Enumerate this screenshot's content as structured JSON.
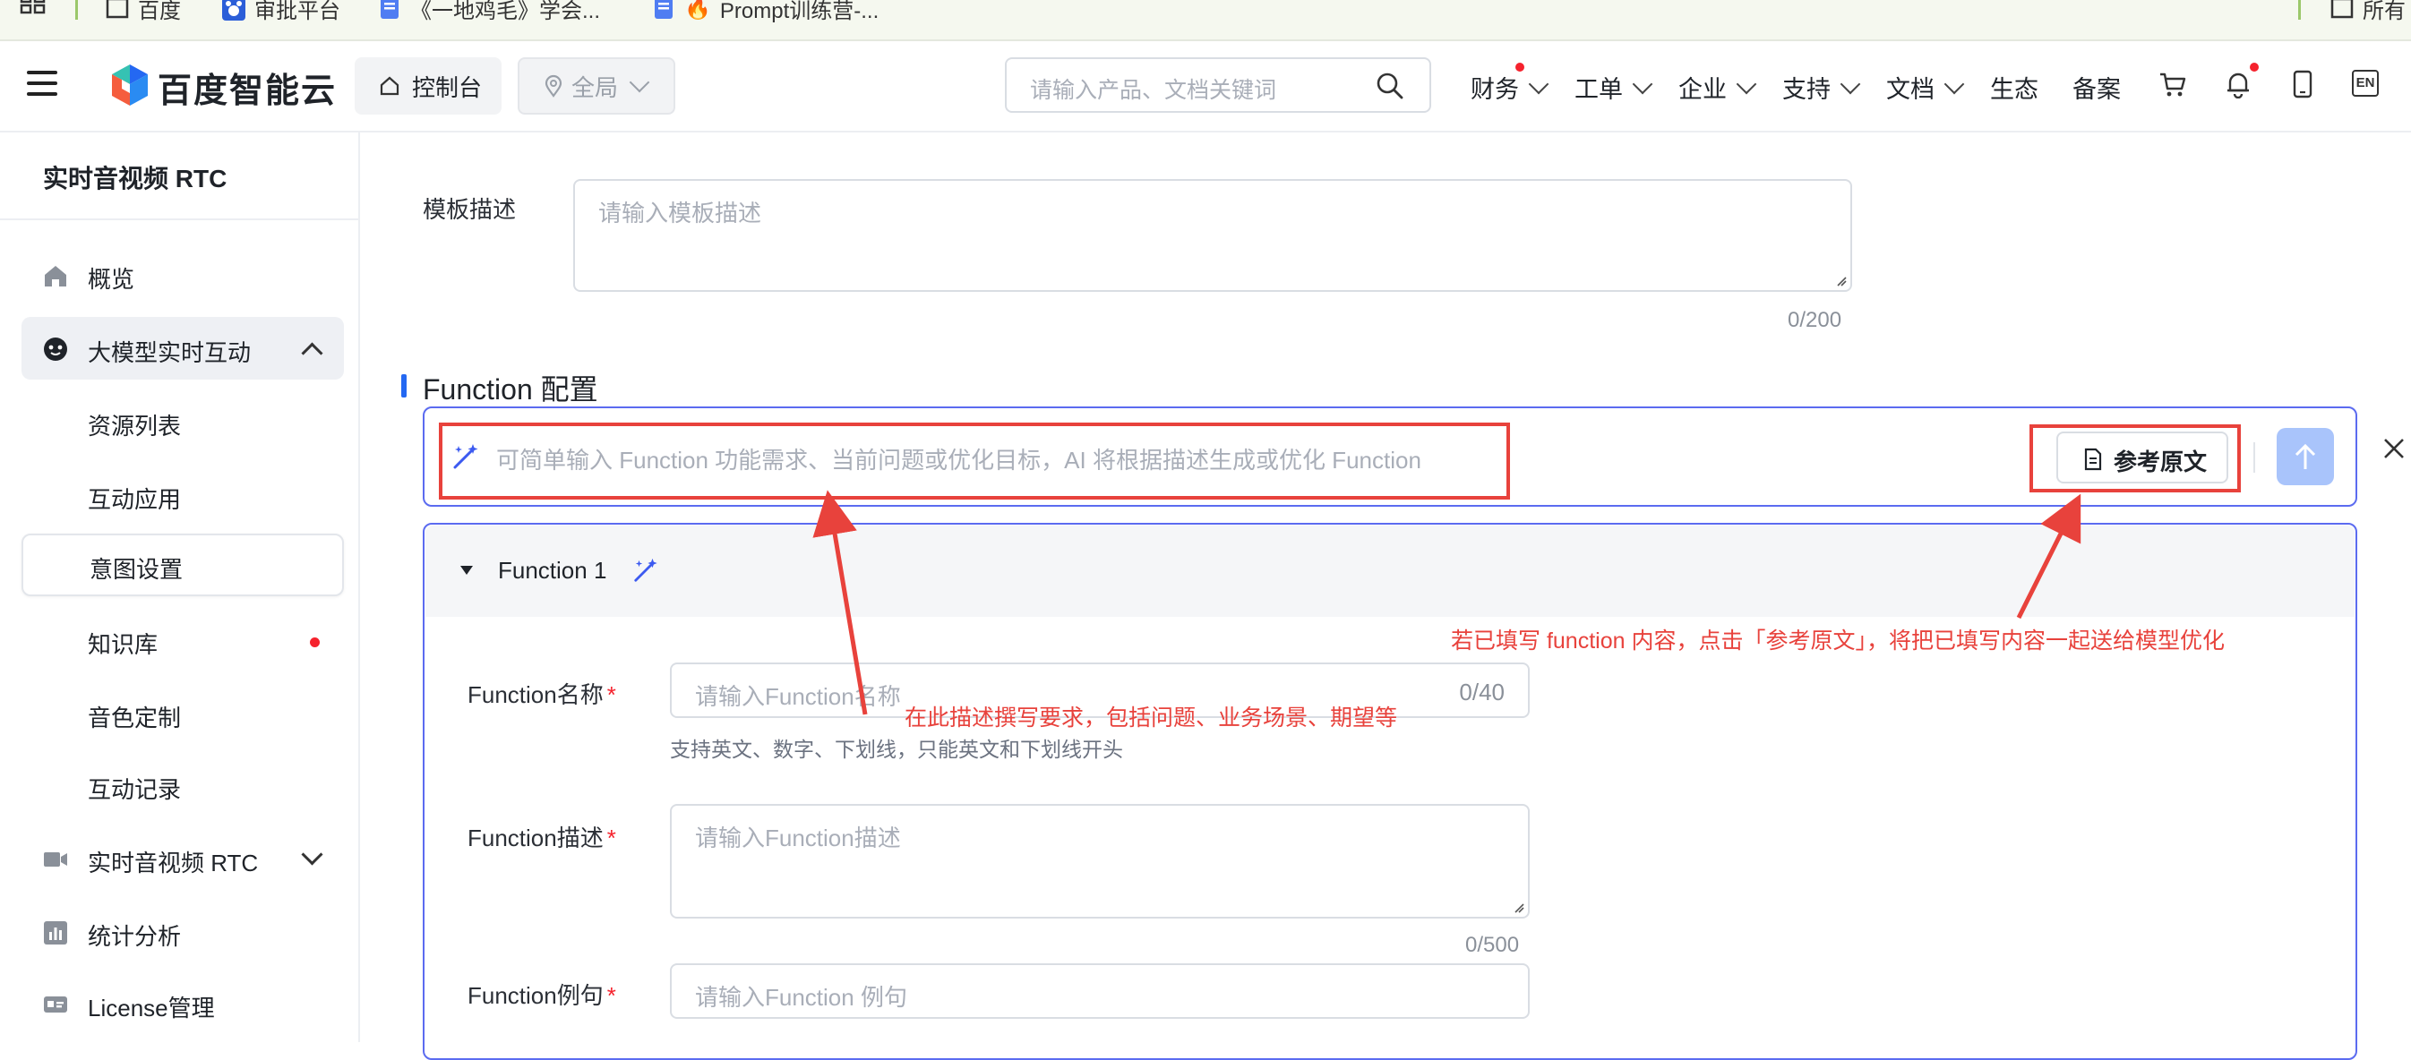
{
  "bookmarks": {
    "items": [
      "百度",
      "审批平台",
      "《一地鸡毛》学会...",
      "Prompt训练营-..."
    ],
    "right_label": "所有"
  },
  "header": {
    "logo_text": "百度智能云",
    "console_label": "控制台",
    "region_label": "全局",
    "search_placeholder": "请输入产品、文档关键词",
    "nav": [
      "财务",
      "工单",
      "企业",
      "支持",
      "文档",
      "生态",
      "备案"
    ],
    "lang_label": "EN"
  },
  "sidebar": {
    "title": "实时音视频 RTC",
    "items": [
      {
        "label": "概览"
      },
      {
        "label": "大模型实时互动"
      },
      {
        "label": "资源列表"
      },
      {
        "label": "互动应用"
      },
      {
        "label": "意图设置"
      },
      {
        "label": "知识库"
      },
      {
        "label": "音色定制"
      },
      {
        "label": "互动记录"
      },
      {
        "label": "实时音视频 RTC"
      },
      {
        "label": "统计分析"
      },
      {
        "label": "License管理"
      }
    ]
  },
  "form": {
    "template_desc_label": "模板描述",
    "template_desc_placeholder": "请输入模板描述",
    "template_desc_counter": "0/200",
    "function_section_title": "Function 配置",
    "ai_input_placeholder": "可简单输入 Function 功能需求、当前问题或优化目标，AI 将根据描述生成或优化 Function",
    "reference_button": "参考原文",
    "function_card_title": "Function 1",
    "name_label": "Function名称",
    "name_placeholder": "请输入Function名称",
    "name_counter": "0/40",
    "name_hint": "支持英文、数字、下划线，只能英文和下划线开头",
    "desc_label": "Function描述",
    "desc_placeholder": "请输入Function描述",
    "desc_counter": "0/500",
    "example_label": "Function例句",
    "example_placeholder": "请输入Function 例句",
    "required_mark": "*"
  },
  "annotations": {
    "right_note": "若已填写 function 内容，点击「参考原文」，将把已填写内容一起送给模型优化",
    "left_note": "在此描述撰写要求，包括问题、业务场景、期望等"
  },
  "colors": {
    "accent": "#2468f2",
    "card_border": "#4d5bd8",
    "annotation": "#e8423c",
    "active_bg": "#eef0f4"
  }
}
